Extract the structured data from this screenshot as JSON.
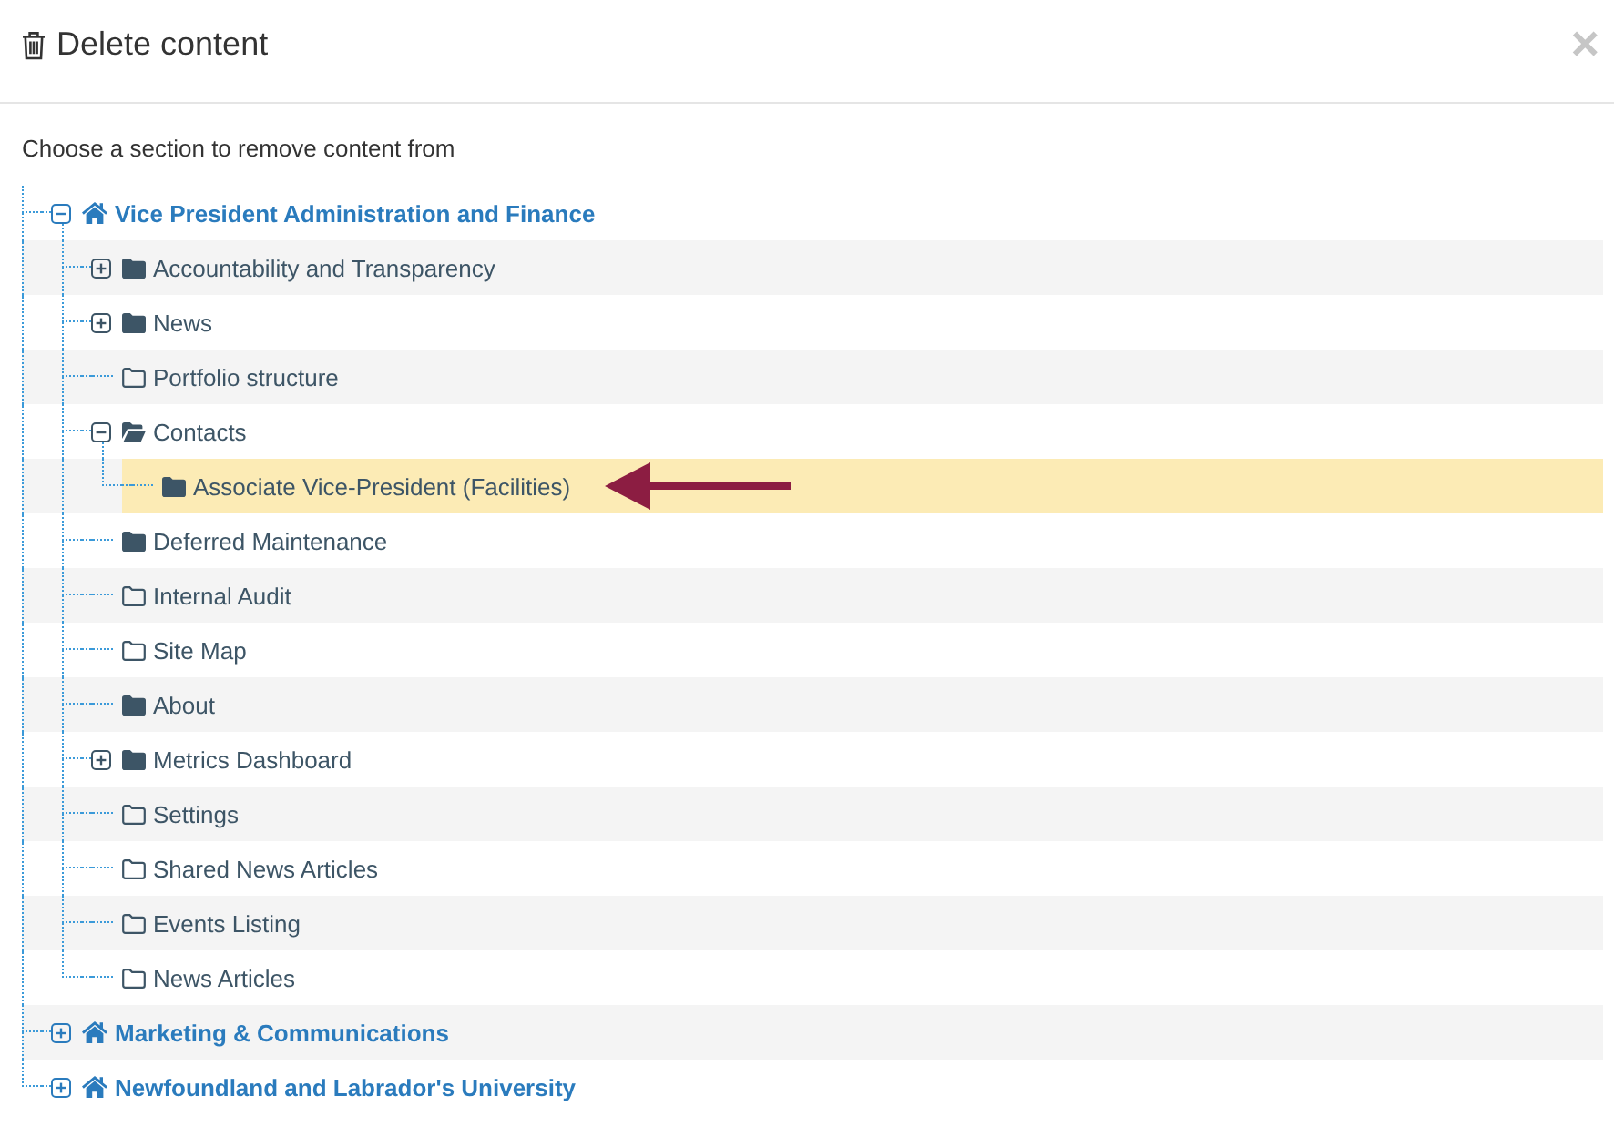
{
  "dialog": {
    "title": "Delete content",
    "close": "×"
  },
  "prompt": "Choose a section to remove content from",
  "tree": [
    {
      "label": "Vice President Administration and Finance",
      "kind": "site",
      "expandable": true,
      "expanded": true,
      "selected": false,
      "children": [
        {
          "label": "Accountability and Transparency",
          "kind": "folder",
          "expandable": true,
          "expanded": false,
          "selected": false
        },
        {
          "label": "News",
          "kind": "folder",
          "expandable": true,
          "expanded": false,
          "selected": false
        },
        {
          "label": "Portfolio structure",
          "kind": "empty-folder",
          "expandable": false,
          "expanded": false,
          "selected": false
        },
        {
          "label": "Contacts",
          "kind": "folder",
          "expandable": true,
          "expanded": true,
          "selected": false,
          "children": [
            {
              "label": "Associate Vice-President (Facilities)",
              "kind": "folder",
              "expandable": false,
              "expanded": false,
              "selected": true
            }
          ]
        },
        {
          "label": "Deferred Maintenance",
          "kind": "folder",
          "expandable": false,
          "expanded": false,
          "selected": false
        },
        {
          "label": "Internal Audit",
          "kind": "empty-folder",
          "expandable": false,
          "expanded": false,
          "selected": false
        },
        {
          "label": "Site Map",
          "kind": "empty-folder",
          "expandable": false,
          "expanded": false,
          "selected": false
        },
        {
          "label": "About",
          "kind": "folder",
          "expandable": false,
          "expanded": false,
          "selected": false
        },
        {
          "label": "Metrics Dashboard",
          "kind": "folder",
          "expandable": true,
          "expanded": false,
          "selected": false
        },
        {
          "label": "Settings",
          "kind": "empty-folder",
          "expandable": false,
          "expanded": false,
          "selected": false
        },
        {
          "label": "Shared News Articles",
          "kind": "empty-folder",
          "expandable": false,
          "expanded": false,
          "selected": false
        },
        {
          "label": "Events Listing",
          "kind": "empty-folder",
          "expandable": false,
          "expanded": false,
          "selected": false
        },
        {
          "label": "News Articles",
          "kind": "empty-folder",
          "expandable": false,
          "expanded": false,
          "selected": false
        }
      ]
    },
    {
      "label": "Marketing & Communications",
      "kind": "site",
      "expandable": true,
      "expanded": false,
      "selected": false
    },
    {
      "label": "Newfoundland and Labrador's University",
      "kind": "site",
      "expandable": true,
      "expanded": false,
      "selected": false
    }
  ]
}
